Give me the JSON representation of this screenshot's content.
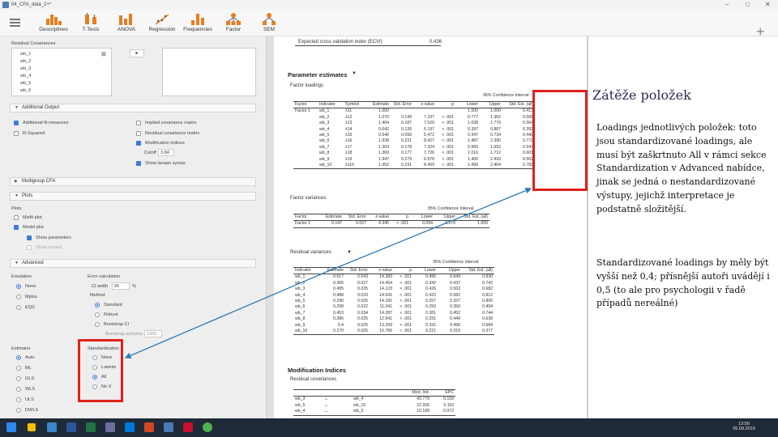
{
  "window": {
    "title": "04_CFA_data_2+*"
  },
  "ribbon": {
    "tabs": [
      {
        "label": "Descriptives"
      },
      {
        "label": "T-Tests"
      },
      {
        "label": "ANOVA"
      },
      {
        "label": "Regression"
      },
      {
        "label": "Frequencies"
      },
      {
        "label": "Factor"
      },
      {
        "label": "SEM"
      }
    ]
  },
  "options": {
    "residual_cov_label": "Residual Covariances",
    "variables": [
      "wb_1",
      "wb_2",
      "wb_3",
      "wb_4",
      "wb_5",
      "wb_6"
    ],
    "additional_output": {
      "header": "Additional Output",
      "left": [
        {
          "label": "Additional fit measures",
          "checked": true
        },
        {
          "label": "R-Squared",
          "checked": false
        }
      ],
      "right": [
        {
          "label": "Implied covariance matrix",
          "checked": false
        },
        {
          "label": "Residual covariance matrix",
          "checked": false
        },
        {
          "label": "Modification indices",
          "checked": true
        },
        {
          "label": "Show lavaan syntax",
          "checked": true
        }
      ],
      "cutoff_label": "Cutoff",
      "cutoff_value": "3.84"
    },
    "multigroup_header": "Multigroup CFA",
    "plots": {
      "header": "Plots",
      "sublabel": "Plots",
      "items": [
        {
          "label": "Misfit plot",
          "checked": false
        },
        {
          "label": "Model plot",
          "checked": true
        },
        {
          "label": "Show parameters",
          "checked": true
        },
        {
          "label": "Show means",
          "checked": false
        }
      ]
    },
    "advanced": {
      "header": "Advanced",
      "emulation_label": "Emulation",
      "emulation": [
        {
          "label": "None",
          "on": true
        },
        {
          "label": "Mplus",
          "on": false
        },
        {
          "label": "EQS",
          "on": false
        }
      ],
      "error_calc_label": "Error calculation",
      "ci_width_label": "CI width",
      "ci_width_value": "95",
      "ci_unit": "%",
      "method_label": "Method",
      "methods": [
        {
          "label": "Standard",
          "on": true
        },
        {
          "label": "Robust",
          "on": false
        },
        {
          "label": "Bootstrap CI",
          "on": false
        }
      ],
      "bootstrap_label": "Bootstrap samples",
      "bootstrap_value": "1000",
      "estimator_label": "Estimator",
      "estimators": [
        {
          "label": "Auto",
          "on": true
        },
        {
          "label": "ML",
          "on": false
        },
        {
          "label": "GLS",
          "on": false
        },
        {
          "label": "WLS",
          "on": false
        },
        {
          "label": "ULS",
          "on": false
        },
        {
          "label": "DWLS",
          "on": false
        }
      ],
      "standardization_label": "Standardization",
      "standardization": [
        {
          "label": "None",
          "on": false
        },
        {
          "label": "Latents",
          "on": false
        },
        {
          "label": "All",
          "on": true
        },
        {
          "label": "No X",
          "on": false
        }
      ]
    }
  },
  "results": {
    "ecvi_label": "Expected cross validation index (ECVI)",
    "ecvi_value": "0.436",
    "param_title": "Parameter estimates",
    "loadings": {
      "title": "Factor loadings",
      "ci_header": "95% Confidence Interval",
      "headers": [
        "Factor",
        "Indicator",
        "Symbol",
        "Estimate",
        "Std. Error",
        "z-value",
        "p",
        "Lower",
        "Upper",
        "Std. Est. (all)"
      ],
      "rows": [
        [
          "Factor 1",
          "wb_1",
          "λ11",
          "1.000",
          "",
          "",
          "",
          "1.000",
          "1.000",
          "0.413"
        ],
        [
          "",
          "wb_2",
          "λ12",
          "1.070",
          "0.149",
          "7.197",
          "< .001",
          "0.777",
          "1.362",
          "0.508"
        ],
        [
          "",
          "wb_3",
          "λ13",
          "1.404",
          "0.187",
          "7.520",
          "< .001",
          "1.038",
          "1.770",
          "0.564"
        ],
        [
          "",
          "wb_4",
          "λ14",
          "0.642",
          "0.126",
          "5.197",
          "< .001",
          "0.397",
          "0.887",
          "0.392"
        ],
        [
          "",
          "wb_5",
          "λ15",
          "0.540",
          "0.099",
          "5.472",
          "< .001",
          "0.347",
          "0.734",
          "0.440"
        ],
        [
          "",
          "wb_6",
          "λ16",
          "1.938",
          "0.231",
          "8.427",
          "< .001",
          "1.487",
          "2.390",
          "0.772"
        ],
        [
          "",
          "wb_7",
          "λ17",
          "1.303",
          "0.178",
          "7.324",
          "< .001",
          "0.955",
          "1.652",
          "0.543"
        ],
        [
          "",
          "wb_8",
          "λ18",
          "1.369",
          "0.177",
          "7.726",
          "< .001",
          "1.016",
          "1.712",
          "0.601"
        ],
        [
          "",
          "wb_9",
          "λ19",
          "1.947",
          "0.279",
          "6.976",
          "< .001",
          "1.400",
          "2.493",
          "0.562"
        ],
        [
          "",
          "wb_10",
          "λ110",
          "1.952",
          "0.231",
          "8.459",
          "< .001",
          "1.499",
          "2.404",
          "0.783"
        ]
      ]
    },
    "factor_var": {
      "title": "Factor variances",
      "ci_header": "95% Confidence Interval",
      "headers": [
        "Factor",
        "Estimate",
        "Std. Error",
        "z-value",
        "p",
        "Lower",
        "Upper",
        "Std. Est. (all)"
      ],
      "rows": [
        [
          "Factor 1",
          "0.147",
          "0.027",
          "4.345",
          "< .001",
          "0.094",
          "0.170",
          "1.000"
        ]
      ]
    },
    "residual_var": {
      "title": "Residual variances",
      "ci_header": "95% Confidence Interval",
      "headers": [
        "Indicator",
        "Estimate",
        "Std. Error",
        "z-value",
        "p",
        "Lower",
        "Upper",
        "Std. Est. (all)"
      ],
      "rows": [
        [
          "wb_1",
          "0.617",
          "0.043",
          "14.383",
          "< .001",
          "0.495",
          "0.649",
          "0.830"
        ],
        [
          "wb_2",
          "0.365",
          "0.027",
          "14.454",
          "< .001",
          "0.342",
          "0.437",
          "0.742"
        ],
        [
          "wb_3",
          "0.495",
          "0.035",
          "14.123",
          "< .001",
          "0.426",
          "0.563",
          "0.682"
        ],
        [
          "wb_4",
          "0.488",
          "0.033",
          "14.541",
          "< .001",
          "0.423",
          "0.582",
          "0.812"
        ],
        [
          "wb_5",
          "0.290",
          "0.025",
          "14.181",
          "< .001",
          "0.257",
          "0.327",
          "0.805"
        ],
        [
          "wb_6",
          "0.298",
          "0.022",
          "11.241",
          "< .001",
          "0.250",
          "0.350",
          "0.404"
        ],
        [
          "wb_7",
          "0.453",
          "0.034",
          "14.287",
          "< .001",
          "0.381",
          "0.452",
          "0.744"
        ],
        [
          "wb_8",
          "0.386",
          "0.025",
          "12.941",
          "< .001",
          "0.331",
          "0.440",
          "0.638"
        ],
        [
          "wb_9",
          "0.4",
          "0.025",
          "13.209",
          "< .001",
          "0.331",
          "0.496",
          "0.684"
        ],
        [
          "wb_10",
          "0.270",
          "0.025",
          "10.765",
          "< .001",
          "0.221",
          "0.319",
          "0.377"
        ]
      ]
    },
    "modification_title": "Modification Indices",
    "residual_cov": {
      "title": "Residual covariances",
      "headers": [
        "",
        "",
        "",
        "Mod. Ind.",
        "EPC"
      ],
      "rows": [
        [
          "wb_3",
          "↔",
          "wb_4",
          "43.779",
          "0.159"
        ],
        [
          "wb_5",
          "↔",
          "wb_10",
          "22.926",
          "0.116"
        ],
        [
          "wb_4",
          "↔",
          "wb_5",
          "15.189",
          "0.072"
        ]
      ]
    }
  },
  "annotation": {
    "title": "Zátěže položek",
    "p1": "Loadings jednotlivých položek: toto jsou standardizované loadings, ale musí být zaškrtnuto All v rámci sekce Standardization v Advanced nabídce, jinak se jedná o nestandardizované výstupy, jejichž interpretace je podstatně složitější.",
    "p2": "Standardizované loadings by měly být vyšší než 0,4; přísnější autoři uvádějí i 0,5 (to ale pro psychologii v řadě případů nereálné)"
  },
  "taskbar": {
    "time": "13:56",
    "date": "05.09.2019"
  },
  "colors": {
    "highlight": "#e0201a",
    "arrow": "#2e7bb4",
    "accent": "#3d7bd6"
  }
}
